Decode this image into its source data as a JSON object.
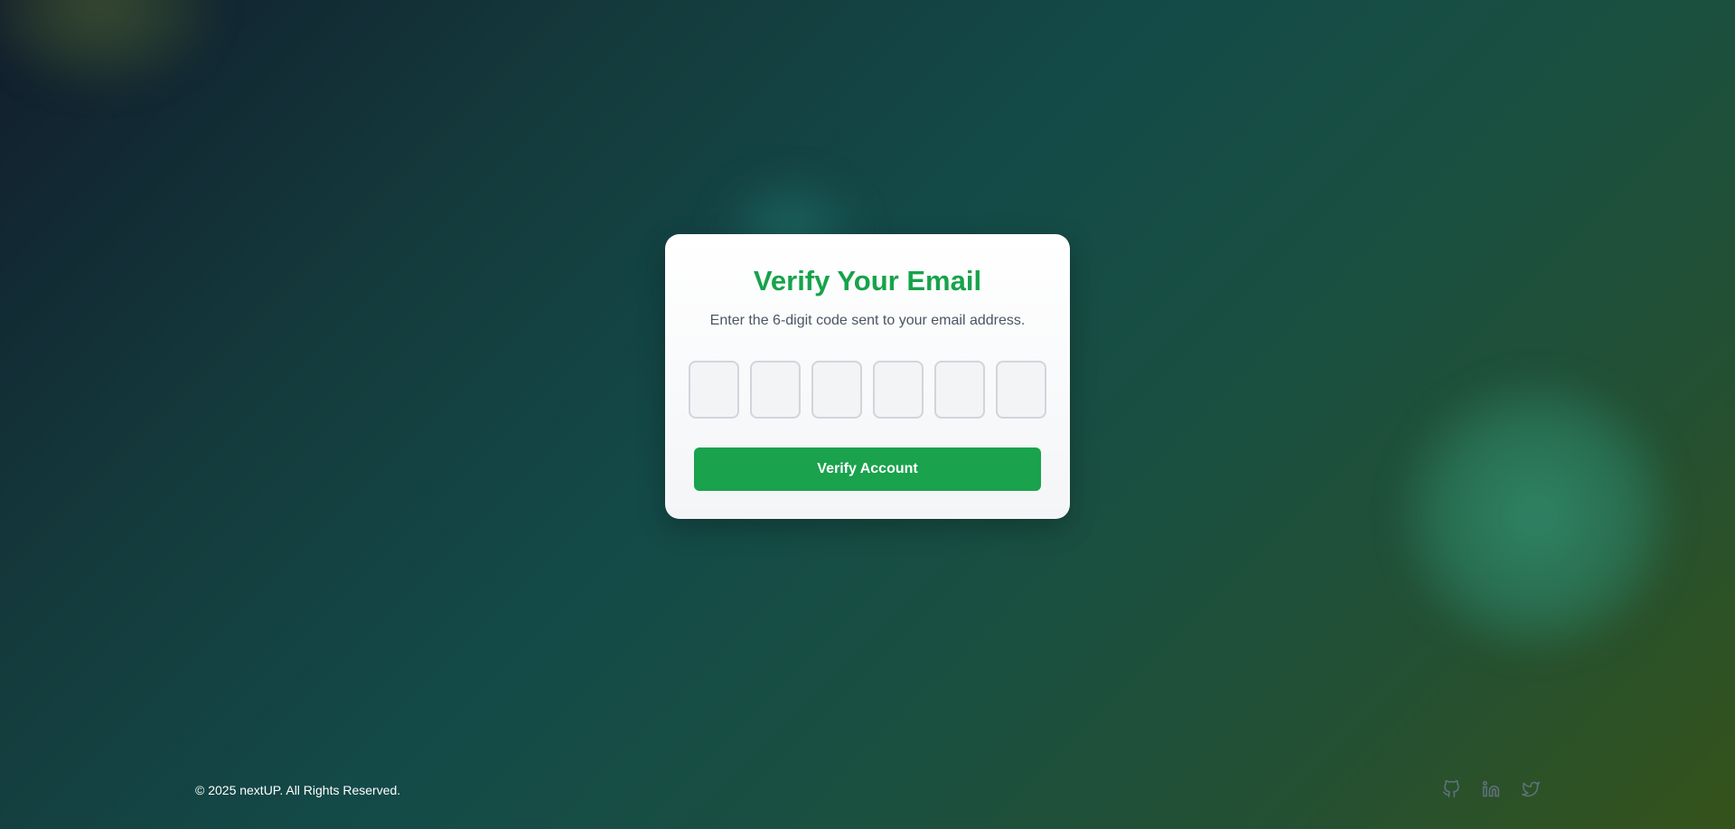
{
  "verify": {
    "title": "Verify Your Email",
    "subtitle": "Enter the 6-digit code sent to your email address.",
    "code_digits": [
      "",
      "",
      "",
      "",
      "",
      ""
    ],
    "button_label": "Verify Account"
  },
  "footer": {
    "copyright": "© 2025 nextUP. All Rights Reserved.",
    "social_icons": [
      "github-icon",
      "linkedin-icon",
      "twitter-icon"
    ]
  },
  "colors": {
    "accent": "#16a34a",
    "button": "#1aa24d",
    "card": "#ffffff"
  }
}
